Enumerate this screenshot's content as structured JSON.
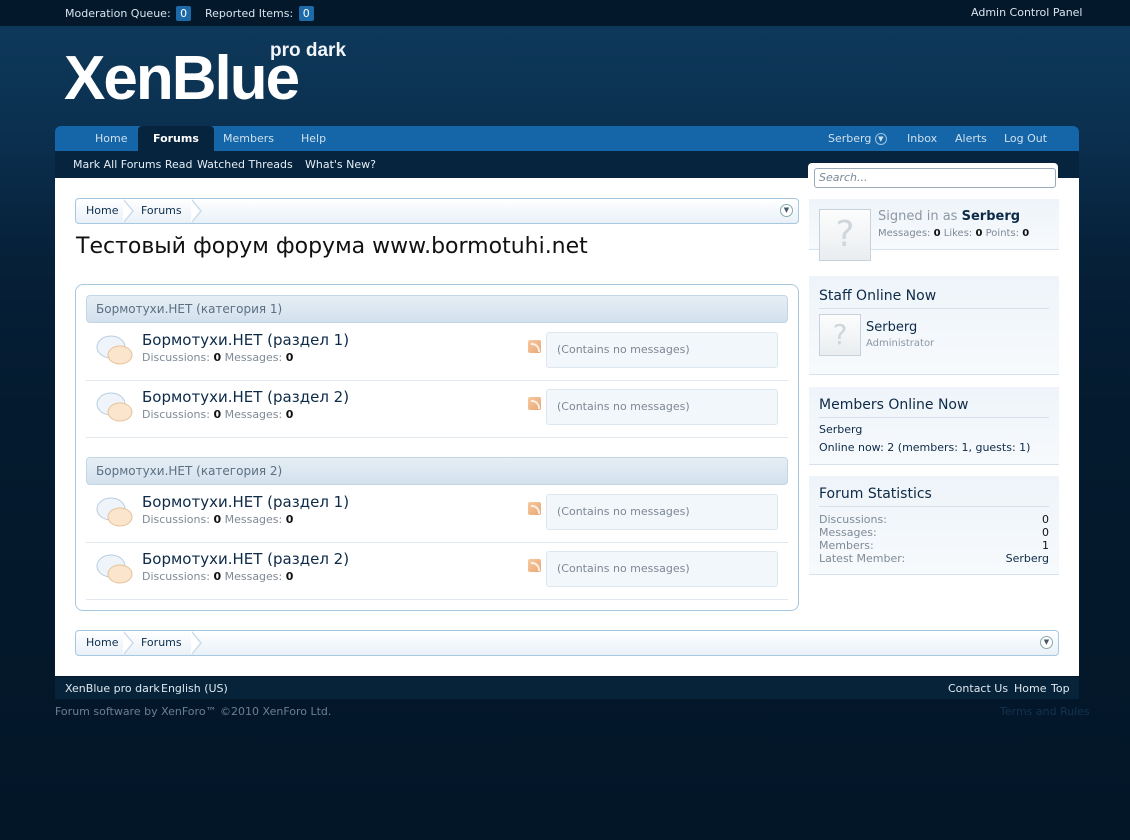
{
  "topbar": {
    "moderation_label": "Moderation Queue:",
    "moderation_count": "0",
    "reported_label": "Reported Items:",
    "reported_count": "0",
    "admin_link": "Admin Control Panel"
  },
  "logo": {
    "main": "XenBlue",
    "sub": "pro dark"
  },
  "nav": {
    "tabs": [
      {
        "label": "Home"
      },
      {
        "label": "Forums"
      },
      {
        "label": "Members"
      },
      {
        "label": "Help"
      }
    ],
    "user": "Serberg",
    "inbox": "Inbox",
    "alerts": "Alerts",
    "logout": "Log Out"
  },
  "subnav": [
    "Mark All Forums Read",
    "Watched Threads",
    "What's New?"
  ],
  "search": {
    "placeholder": "Search..."
  },
  "breadcrumb": [
    "Home",
    "Forums"
  ],
  "page_title": "Тестовый форум форума www.bormotuhi.net",
  "categories": [
    {
      "name": "Бормотухи.НЕТ (категория 1)",
      "forums": [
        {
          "title": "Бормотухи.НЕТ (раздел 1)",
          "discussions": "0",
          "messages": "0",
          "lastpost": "(Contains no messages)"
        },
        {
          "title": "Бормотухи.НЕТ (раздел 2)",
          "discussions": "0",
          "messages": "0",
          "lastpost": "(Contains no messages)"
        }
      ]
    },
    {
      "name": "Бормотухи.НЕТ (категория 2)",
      "forums": [
        {
          "title": "Бормотухи.НЕТ (раздел 1)",
          "discussions": "0",
          "messages": "0",
          "lastpost": "(Contains no messages)"
        },
        {
          "title": "Бормотухи.НЕТ (раздел 2)",
          "discussions": "0",
          "messages": "0",
          "lastpost": "(Contains no messages)"
        }
      ]
    }
  ],
  "labels": {
    "discussions": "Discussions:",
    "messages": "Messages:"
  },
  "sidebar": {
    "signed_in": {
      "prefix": "Signed in as",
      "user": "Serberg",
      "messages_label": "Messages:",
      "messages": "0",
      "likes_label": "Likes:",
      "likes": "0",
      "points_label": "Points:",
      "points": "0"
    },
    "staff": {
      "title": "Staff Online Now",
      "name": "Serberg",
      "role": "Administrator"
    },
    "members": {
      "title": "Members Online Now",
      "list": "Serberg",
      "online": "Online now: 2 (members: 1, guests: 1)"
    },
    "stats": {
      "title": "Forum Statistics",
      "rows": [
        {
          "label": "Discussions:",
          "value": "0"
        },
        {
          "label": "Messages:",
          "value": "0"
        },
        {
          "label": "Members:",
          "value": "1"
        },
        {
          "label": "Latest Member:",
          "value": "Serberg"
        }
      ]
    }
  },
  "footer": {
    "style": "XenBlue pro dark",
    "language": "English (US)",
    "contact": "Contact Us",
    "home": "Home",
    "top": "Top",
    "copyright": "Forum software by XenForo™ ©2010 XenForo Ltd.",
    "terms": "Terms and Rules"
  },
  "colors": {
    "accent": "#1466a8",
    "dark": "#06243e",
    "page": "#ffffff"
  }
}
